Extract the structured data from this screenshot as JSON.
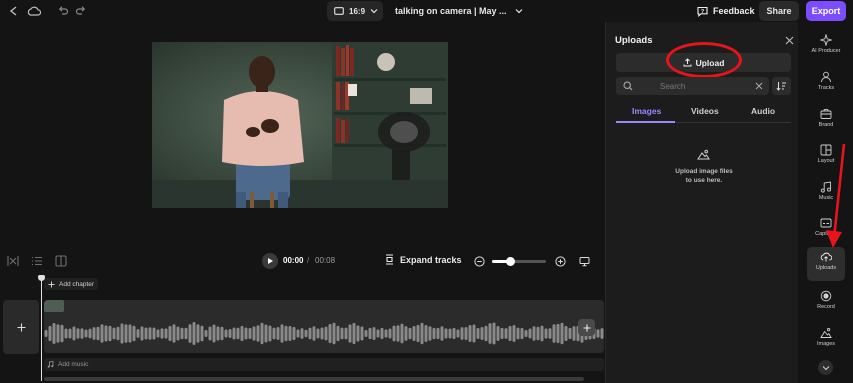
{
  "topbar": {
    "aspect_ratio": "16:9",
    "project_title": "talking on camera | May ...",
    "feedback_label": "Feedback",
    "share_label": "Share",
    "export_label": "Export"
  },
  "player": {
    "current_time": "00:00",
    "separator": "/",
    "total_time": "00:08",
    "expand_label": "Expand tracks",
    "zoom_level": 0.35
  },
  "timeline": {
    "add_chapter_label": "Add chapter",
    "add_music_label": "Add music"
  },
  "uploads_panel": {
    "title": "Uploads",
    "upload_button_label": "Upload",
    "search_placeholder": "Search",
    "tabs": [
      "Images",
      "Videos",
      "Audio"
    ],
    "active_tab": "Images",
    "empty_line1": "Upload image files",
    "empty_line2": "to use here."
  },
  "rail": {
    "items": [
      {
        "label": "AI Producer",
        "icon": "sparkle-icon"
      },
      {
        "label": "Tracks",
        "icon": "person-icon"
      },
      {
        "label": "Brand",
        "icon": "briefcase-icon"
      },
      {
        "label": "Layout",
        "icon": "layout-icon"
      },
      {
        "label": "Music",
        "icon": "music-note-icon"
      },
      {
        "label": "Captions",
        "icon": "captions-icon"
      },
      {
        "label": "Uploads",
        "icon": "cloud-upload-icon",
        "active": true
      },
      {
        "label": "Record",
        "icon": "record-icon"
      },
      {
        "label": "Images",
        "icon": "image-icon"
      }
    ]
  },
  "colors": {
    "accent": "#7c4dff",
    "active_tab": "#9d86ff",
    "annotation": "#e8141c"
  }
}
